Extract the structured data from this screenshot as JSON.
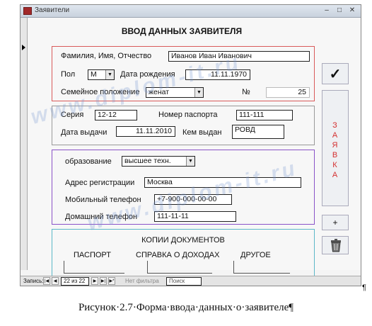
{
  "window": {
    "title": "Заявители",
    "buttons": {
      "minimize": "–",
      "maximize": "□",
      "close": "✕"
    }
  },
  "form": {
    "heading": "ВВОД ДАННЫХ ЗАЯВИТЕЛЯ",
    "personal": {
      "fio_label": "Фамилия, Имя, Отчество",
      "fio_value": "Иванов Иван Иванович",
      "sex_label": "Пол",
      "sex_value": "М",
      "birth_label": "Дата рождения",
      "birth_value": "11.11.1970",
      "marital_label": "Семейное положение",
      "marital_value": "женат",
      "number_label": "№",
      "number_value": "25"
    },
    "passport": {
      "series_label": "Серия",
      "series_value": "12-12",
      "number_label": "Номер паспорта",
      "number_value": "111-111",
      "issue_date_label": "Дата выдачи",
      "issue_date_value": "11.11.2010",
      "issued_by_label": "Кем выдан",
      "issued_by_value": "РОВД"
    },
    "contacts": {
      "education_label": "образование",
      "education_value": "высшее техн.",
      "address_label": "Адрес регистрации",
      "address_value": "Москва",
      "mobile_label": "Мобильный телефон",
      "mobile_value": "+7-900-000-00-00",
      "home_label": "Домашний телефон",
      "home_value": "111-11-11"
    },
    "documents": {
      "title": "КОПИИ ДОКУМЕНТОВ",
      "passport": "ПАСПОРТ",
      "income": "СПРАВКА О ДОХОДАХ",
      "other": "ДРУГОЕ"
    },
    "side_buttons": {
      "confirm_glyph": "✓",
      "zayavka": "З\nА\nЯ\nВ\nК\nА",
      "new_glyph": "+"
    }
  },
  "navigation": {
    "records_label": "Запись:",
    "current": "22 из 22",
    "filter_label": "Нет фильтра",
    "search_label": "Поиск"
  },
  "watermark": "www.diplom-it.ru",
  "pilcrow": "¶",
  "caption": "Рисунок·2.7·Форма·ввода·данных·о·заявителе¶"
}
